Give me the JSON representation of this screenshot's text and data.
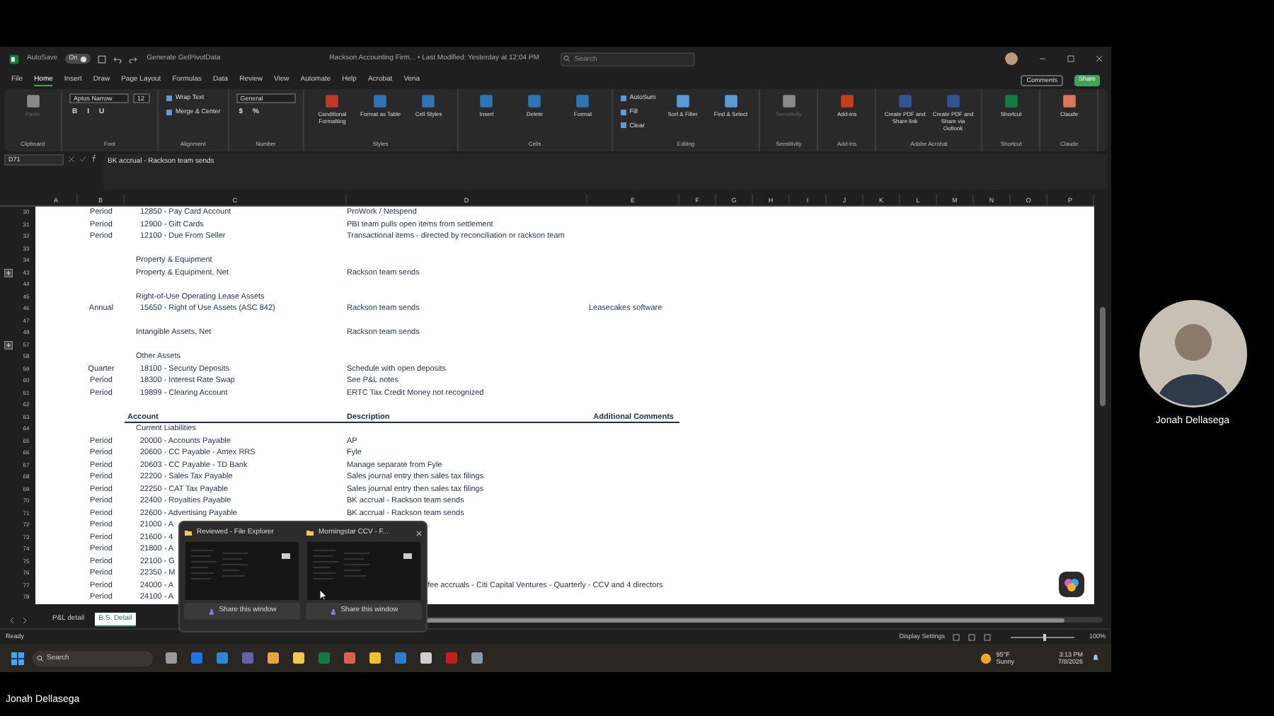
{
  "title_bar": {
    "autosave_label": "AutoSave",
    "autosave": {
      "on": true,
      "label": "On"
    },
    "pivot_button": "Generate GetPivotData",
    "title": "Rackson Accounting Firm... • Last Modified: Yesterday at 12:04 PM",
    "search": {
      "placeholder": "Search"
    }
  },
  "menu": [
    {
      "label": "File",
      "selected": false
    },
    {
      "label": "Home",
      "selected": true
    },
    {
      "label": "Insert",
      "selected": false
    },
    {
      "label": "Draw",
      "selected": false
    },
    {
      "label": "Page Layout",
      "selected": false
    },
    {
      "label": "Formulas",
      "selected": false
    },
    {
      "label": "Data",
      "selected": false
    },
    {
      "label": "Review",
      "selected": false
    },
    {
      "label": "View",
      "selected": false
    },
    {
      "label": "Automate",
      "selected": false
    },
    {
      "label": "Help",
      "selected": false
    },
    {
      "label": "Acrobat",
      "selected": false
    },
    {
      "label": "Vena",
      "selected": false
    }
  ],
  "comments_button": "Comments",
  "share_button": "Share",
  "ribbon": [
    {
      "name": "Clipboard",
      "parts": [
        {
          "kind": "large",
          "label": "Paste",
          "color": "#8a8a8a",
          "disabled": true
        }
      ]
    },
    {
      "name": "Font",
      "parts": [
        {
          "kind": "stack",
          "lines": [
            {
              "items": [
                {
                  "kind": "field",
                  "value": "Aptos Narrow"
                },
                {
                  "kind": "field",
                  "value": "12"
                }
              ]
            },
            {
              "items": [
                {
                  "kind": "glyph",
                  "label": "B"
                },
                {
                  "kind": "glyph",
                  "label": "I"
                },
                {
                  "kind": "glyph",
                  "label": "U"
                }
              ]
            }
          ]
        }
      ]
    },
    {
      "name": "Alignment",
      "parts": [
        {
          "kind": "stack",
          "lines": [
            {
              "items": [
                {
                  "kind": "small",
                  "label": "Wrap Text"
                }
              ]
            },
            {
              "items": [
                {
                  "kind": "small",
                  "label": "Merge & Center"
                }
              ]
            }
          ]
        }
      ]
    },
    {
      "name": "Number",
      "parts": [
        {
          "kind": "stack",
          "lines": [
            {
              "items": [
                {
                  "kind": "field",
                  "value": "General"
                }
              ]
            },
            {
              "items": [
                {
                  "kind": "glyph",
                  "label": "$"
                },
                {
                  "kind": "glyph",
                  "label": "%"
                }
              ]
            }
          ]
        }
      ]
    },
    {
      "name": "Styles",
      "parts": [
        {
          "kind": "large",
          "label": "Conditional Formatting",
          "color": "#c0392b",
          "disabled": false
        },
        {
          "kind": "large",
          "label": "Format as Table",
          "color": "#2e75b6",
          "disabled": false
        },
        {
          "kind": "large",
          "label": "Cell Styles",
          "color": "#2e75b6",
          "disabled": false
        }
      ]
    },
    {
      "name": "Cells",
      "parts": [
        {
          "kind": "large",
          "label": "Insert",
          "color": "#2e75b6",
          "disabled": false
        },
        {
          "kind": "large",
          "label": "Delete",
          "color": "#2e75b6",
          "disabled": false
        },
        {
          "kind": "large",
          "label": "Format",
          "color": "#2e75b6",
          "disabled": false
        }
      ]
    },
    {
      "name": "Editing",
      "parts": [
        {
          "kind": "stack",
          "lines": [
            {
              "items": [
                {
                  "kind": "small",
                  "label": "AutoSum"
                }
              ]
            },
            {
              "items": [
                {
                  "kind": "small",
                  "label": "Fill"
                }
              ]
            },
            {
              "items": [
                {
                  "kind": "small",
                  "label": "Clear"
                }
              ]
            }
          ]
        },
        {
          "kind": "large",
          "label": "Sort & Filter",
          "color": "#5b9bd5",
          "disabled": false
        },
        {
          "kind": "large",
          "label": "Find & Select",
          "color": "#5b9bd5",
          "disabled": false
        }
      ]
    },
    {
      "name": "Sensitivity",
      "parts": [
        {
          "kind": "large",
          "label": "Sensitivity",
          "color": "#8a8a8a",
          "disabled": true
        }
      ]
    },
    {
      "name": "Add-ins",
      "parts": [
        {
          "kind": "large",
          "label": "Add-ins",
          "color": "#c43e1c",
          "disabled": false
        }
      ]
    },
    {
      "name": "Adobe Acrobat",
      "parts": [
        {
          "kind": "large",
          "label": "Create PDF and Share link",
          "color": "#2f5597",
          "disabled": false
        },
        {
          "kind": "large",
          "label": "Create PDF and Share via Outlook",
          "color": "#2f5597",
          "disabled": false
        }
      ]
    },
    {
      "name": "Shortcut",
      "parts": [
        {
          "kind": "large",
          "label": "Shortcut",
          "color": "#107c41",
          "disabled": false
        }
      ]
    },
    {
      "name": "Claude",
      "parts": [
        {
          "kind": "large",
          "label": "Claude",
          "color": "#d97757",
          "disabled": false
        }
      ]
    }
  ],
  "formula_bar": {
    "name_box": "D71",
    "content": "BK accrual - Rackson team sends"
  },
  "columns": [
    "A",
    "B",
    "C",
    "D",
    "E",
    "F",
    "G",
    "H",
    "I",
    "J",
    "K",
    "L",
    "M",
    "N",
    "O",
    "P"
  ],
  "rows": [
    {
      "number": "30",
      "kind": "item",
      "collapsed": false,
      "b": "Period",
      "c": "12850 - Pay Card Account",
      "d": "ProWork / Netspend"
    },
    {
      "number": "31",
      "kind": "item",
      "collapsed": false,
      "b": "Period",
      "c": "12900 - Gift Cards",
      "d": "PBI team pulls open items from settlement"
    },
    {
      "number": "32",
      "kind": "item",
      "collapsed": false,
      "b": "Period",
      "c": "12100 - Due From Seller",
      "d": "Transactional items - directed by reconciliation or rackson team"
    },
    {
      "number": "33",
      "kind": "blank",
      "collapsed": false
    },
    {
      "number": "34",
      "kind": "group",
      "collapsed": false,
      "c": "Property & Equipment"
    },
    {
      "number": "43",
      "kind": "group",
      "collapsed": true,
      "c": "Property & Equipment, Net",
      "d": "Rackson team sends"
    },
    {
      "number": "44",
      "kind": "blank",
      "collapsed": false
    },
    {
      "number": "45",
      "kind": "group",
      "collapsed": false,
      "c": "Right-of-Use Operating Lease Assets"
    },
    {
      "number": "46",
      "kind": "item",
      "collapsed": false,
      "b": "Annual",
      "c": "15650 - Right of Use Assets (ASC 842)",
      "d": "Rackson team sends",
      "e": "Leasecakes software"
    },
    {
      "number": "47",
      "kind": "blank",
      "collapsed": false
    },
    {
      "number": "48",
      "kind": "group",
      "collapsed": false,
      "c": "Intangible Assets, Net",
      "d": "Rackson team sends"
    },
    {
      "number": "57",
      "kind": "blank",
      "collapsed": true
    },
    {
      "number": "58",
      "kind": "group",
      "collapsed": false,
      "c": "Other Assets"
    },
    {
      "number": "59",
      "kind": "item",
      "collapsed": false,
      "b": "Quarter",
      "c": "18100 - Security Deposits",
      "d": "Schedule with open deposits"
    },
    {
      "number": "60",
      "kind": "item",
      "collapsed": false,
      "b": "Period",
      "c": "18300 - Interest Rate Swap",
      "d": "See P&L notes"
    },
    {
      "number": "61",
      "kind": "item",
      "collapsed": false,
      "b": "Period",
      "c": "19899 - Clearing Account",
      "d": "ERTC Tax Credit Money not recognized"
    },
    {
      "number": "62",
      "kind": "blank",
      "collapsed": false
    },
    {
      "number": "63",
      "kind": "header",
      "collapsed": false,
      "c": "Account",
      "d": "Description",
      "e": "Additional Comments"
    },
    {
      "number": "64",
      "kind": "group",
      "collapsed": false,
      "c": "Current Liabilities"
    },
    {
      "number": "65",
      "kind": "item",
      "collapsed": false,
      "b": "Period",
      "c": "20000 - Accounts Payable",
      "d": "AP"
    },
    {
      "number": "66",
      "kind": "item",
      "collapsed": false,
      "b": "Period",
      "c": "20600 - CC Payable - Amex RRS",
      "d": "Fyle"
    },
    {
      "number": "67",
      "kind": "item",
      "collapsed": false,
      "b": "Period",
      "c": "20603 - CC Payable - TD Bank",
      "d": "Manage separate from Fyle"
    },
    {
      "number": "68",
      "kind": "item",
      "collapsed": false,
      "b": "Period",
      "c": "22200 - Sales Tax Payable",
      "d": "Sales journal entry then sales tax filings"
    },
    {
      "number": "69",
      "kind": "item",
      "collapsed": false,
      "b": "Period",
      "c": "22250 - CAT Tax Payable",
      "d": "Sales journal entry then sales tax filings"
    },
    {
      "number": "70",
      "kind": "item",
      "collapsed": false,
      "b": "Period",
      "c": "22400 - Royalties Payable",
      "d": "BK accrual - Rackson team sends"
    },
    {
      "number": "71",
      "kind": "item",
      "collapsed": false,
      "b": "Period",
      "c": "22600 - Advertising Payable",
      "d": "BK accrual - Rackson team sends"
    },
    {
      "number": "72",
      "kind": "covered",
      "collapsed": false,
      "b": "Period",
      "c": "21000 - A"
    },
    {
      "number": "73",
      "kind": "covered",
      "collapsed": false,
      "b": "Period",
      "c": "21600 - 4"
    },
    {
      "number": "74",
      "kind": "covered",
      "collapsed": false,
      "b": "Period",
      "c": "21800 - A"
    },
    {
      "number": "75",
      "kind": "covered",
      "collapsed": false,
      "b": "Period",
      "c": "22100 - G"
    },
    {
      "number": "76",
      "kind": "covered",
      "collapsed": false,
      "b": "Period",
      "c": "22350 - M"
    },
    {
      "number": "77",
      "kind": "covered",
      "collapsed": false,
      "b": "Period",
      "c": "24000 - A",
      "d": "fee accruals - Citi Capital Ventures - Quarterly - CCV and 4 directors"
    },
    {
      "number": "78",
      "kind": "covered",
      "collapsed": false,
      "b": "Period",
      "c": "24100 - A"
    }
  ],
  "sheet_tabs": [
    {
      "label": "P&L detail",
      "selected": false
    },
    {
      "label": "B.S. Detail",
      "selected": true
    }
  ],
  "status_bar": {
    "status": "Ready",
    "display_settings": "Display Settings",
    "zoom": {
      "level": 0.5,
      "reading": "100%"
    }
  },
  "share_popup": [
    {
      "title": "Reviewed - File Explorer",
      "button": "Share this window"
    },
    {
      "title": "Morningstar CCV - F...",
      "button": "Share this window"
    }
  ],
  "taskbar": {
    "search": {
      "placeholder": "Search"
    },
    "weather": {
      "temperature": "95°F",
      "condition": "Sunny"
    },
    "time": "3:13 PM",
    "date": "7/8/2026"
  },
  "video_tile": {
    "name": "Jonah Dellasega"
  },
  "presenter_name": "Jonah Dellasega"
}
